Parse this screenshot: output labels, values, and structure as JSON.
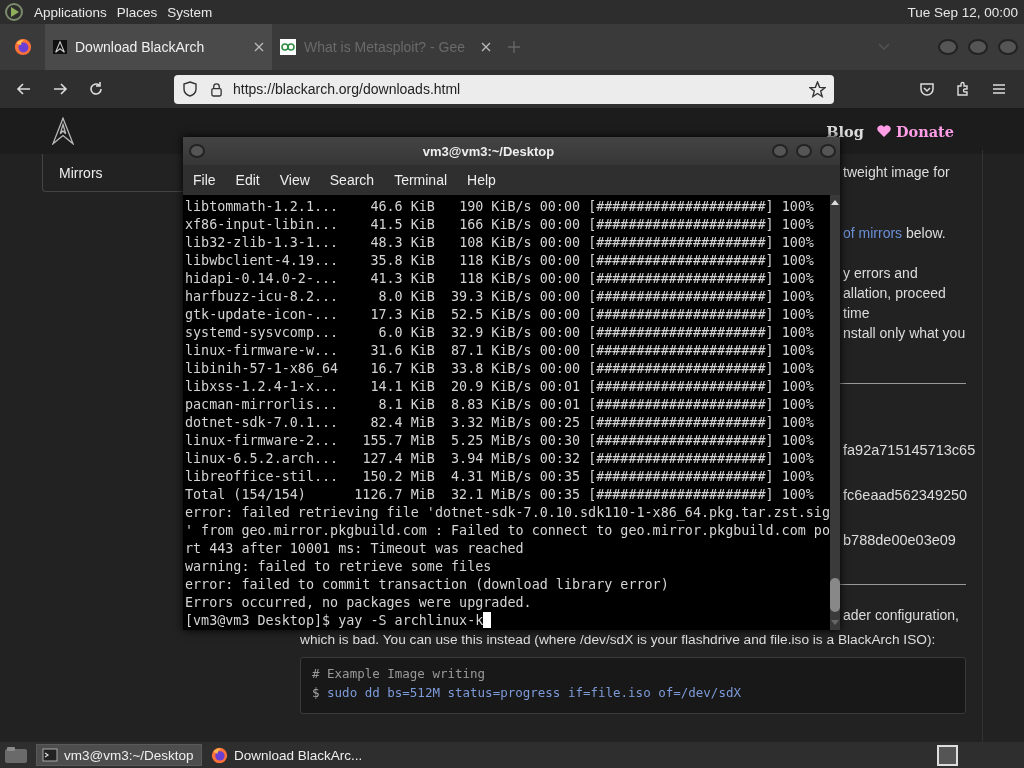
{
  "top_panel": {
    "menus": [
      "Applications",
      "Places",
      "System"
    ],
    "clock": "Tue Sep 12, 00:00"
  },
  "browser": {
    "tabs": [
      {
        "title": "Download BlackArch",
        "selected": true,
        "kind": "blackarch"
      },
      {
        "title": "What is Metasploit? - Gee",
        "selected": false,
        "kind": "geeks"
      }
    ],
    "url": "https://blackarch.org/downloads.html"
  },
  "page": {
    "nav": [
      {
        "label": "Blog",
        "kind": "plain"
      },
      {
        "label": "Donate",
        "kind": "donate"
      }
    ],
    "sidebar": [
      "Mirrors"
    ],
    "content": {
      "intro_fragment": "tweight image for",
      "mirrors_fragment": {
        "link": "of mirrors",
        "text": " below."
      },
      "warning_fragments": [
        "y errors and",
        "allation, proceed",
        "time",
        "nstall only what you"
      ],
      "checksums": [
        "fa92a715145713c65",
        "fc6eaad562349250",
        "b788de00e03e09"
      ],
      "note_fragment": "ader configuration,",
      "note_line": "which is bad. You can use this instead (where /dev/sdX is your flashdrive and file.iso is a BlackArch ISO):",
      "code": {
        "comment": "# Example Image writing",
        "prompt": "$",
        "command": "sudo dd bs=512M status=progress if=file.iso of=/dev/sdX"
      }
    }
  },
  "terminal": {
    "title": "vm3@vm3:~/Desktop",
    "menu": [
      "File",
      "Edit",
      "View",
      "Search",
      "Terminal",
      "Help"
    ],
    "downloads": [
      {
        "name": "libtommath-1.2.1...",
        "size": "46.6 KiB",
        "rate": "190 KiB/s",
        "time": "00:00",
        "bar": "[#####################]",
        "percent": "100%"
      },
      {
        "name": "xf86-input-libin...",
        "size": "41.5 KiB",
        "rate": "166 KiB/s",
        "time": "00:00",
        "bar": "[#####################]",
        "percent": "100%"
      },
      {
        "name": "lib32-zlib-1.3-1...",
        "size": "48.3 KiB",
        "rate": "108 KiB/s",
        "time": "00:00",
        "bar": "[#####################]",
        "percent": "100%"
      },
      {
        "name": "libwbclient-4.19...",
        "size": "35.8 KiB",
        "rate": "118 KiB/s",
        "time": "00:00",
        "bar": "[#####################]",
        "percent": "100%"
      },
      {
        "name": "hidapi-0.14.0-2-...",
        "size": "41.3 KiB",
        "rate": "118 KiB/s",
        "time": "00:00",
        "bar": "[#####################]",
        "percent": "100%"
      },
      {
        "name": "harfbuzz-icu-8.2...",
        "size": "8.0 KiB",
        "rate": "39.3 KiB/s",
        "time": "00:00",
        "bar": "[#####################]",
        "percent": "100%"
      },
      {
        "name": "gtk-update-icon-...",
        "size": "17.3 KiB",
        "rate": "52.5 KiB/s",
        "time": "00:00",
        "bar": "[#####################]",
        "percent": "100%"
      },
      {
        "name": "systemd-sysvcomp...",
        "size": "6.0 KiB",
        "rate": "32.9 KiB/s",
        "time": "00:00",
        "bar": "[#####################]",
        "percent": "100%"
      },
      {
        "name": "linux-firmware-w...",
        "size": "31.6 KiB",
        "rate": "87.1 KiB/s",
        "time": "00:00",
        "bar": "[#####################]",
        "percent": "100%"
      },
      {
        "name": "libinih-57-1-x86_64",
        "size": "16.7 KiB",
        "rate": "33.8 KiB/s",
        "time": "00:00",
        "bar": "[#####################]",
        "percent": "100%"
      },
      {
        "name": "libxss-1.2.4-1-x...",
        "size": "14.1 KiB",
        "rate": "20.9 KiB/s",
        "time": "00:01",
        "bar": "[#####################]",
        "percent": "100%"
      },
      {
        "name": "pacman-mirrorlis...",
        "size": "8.1 KiB",
        "rate": "8.83 KiB/s",
        "time": "00:01",
        "bar": "[#####################]",
        "percent": "100%"
      },
      {
        "name": "dotnet-sdk-7.0.1...",
        "size": "82.4 MiB",
        "rate": "3.32 MiB/s",
        "time": "00:25",
        "bar": "[#####################]",
        "percent": "100%"
      },
      {
        "name": "linux-firmware-2...",
        "size": "155.7 MiB",
        "rate": "5.25 MiB/s",
        "time": "00:30",
        "bar": "[#####################]",
        "percent": "100%"
      },
      {
        "name": "linux-6.5.2.arch...",
        "size": "127.4 MiB",
        "rate": "3.94 MiB/s",
        "time": "00:32",
        "bar": "[#####################]",
        "percent": "100%"
      },
      {
        "name": "libreoffice-stil...",
        "size": "150.2 MiB",
        "rate": "4.31 MiB/s",
        "time": "00:35",
        "bar": "[#####################]",
        "percent": "100%"
      },
      {
        "name": "Total (154/154)",
        "size": "1126.7 MiB",
        "rate": "32.1 MiB/s",
        "time": "00:35",
        "bar": "[#####################]",
        "percent": "100%"
      }
    ],
    "messages": [
      "error: failed retrieving file 'dotnet-sdk-7.0.10.sdk110-1-x86_64.pkg.tar.zst.sig",
      "' from geo.mirror.pkgbuild.com : Failed to connect to geo.mirror.pkgbuild.com po",
      "rt 443 after 10001 ms: Timeout was reached",
      "warning: failed to retrieve some files",
      "error: failed to commit transaction (download library error)",
      "Errors occurred, no packages were upgraded."
    ],
    "prompt": "[vm3@vm3 Desktop]$",
    "input": "yay -S archlinux-k"
  },
  "taskbar": {
    "tasks": [
      {
        "title": "vm3@vm3:~/Desktop",
        "kind": "terminal",
        "selected": true
      },
      {
        "title": "Download BlackArc...",
        "kind": "firefox",
        "selected": false
      }
    ]
  }
}
